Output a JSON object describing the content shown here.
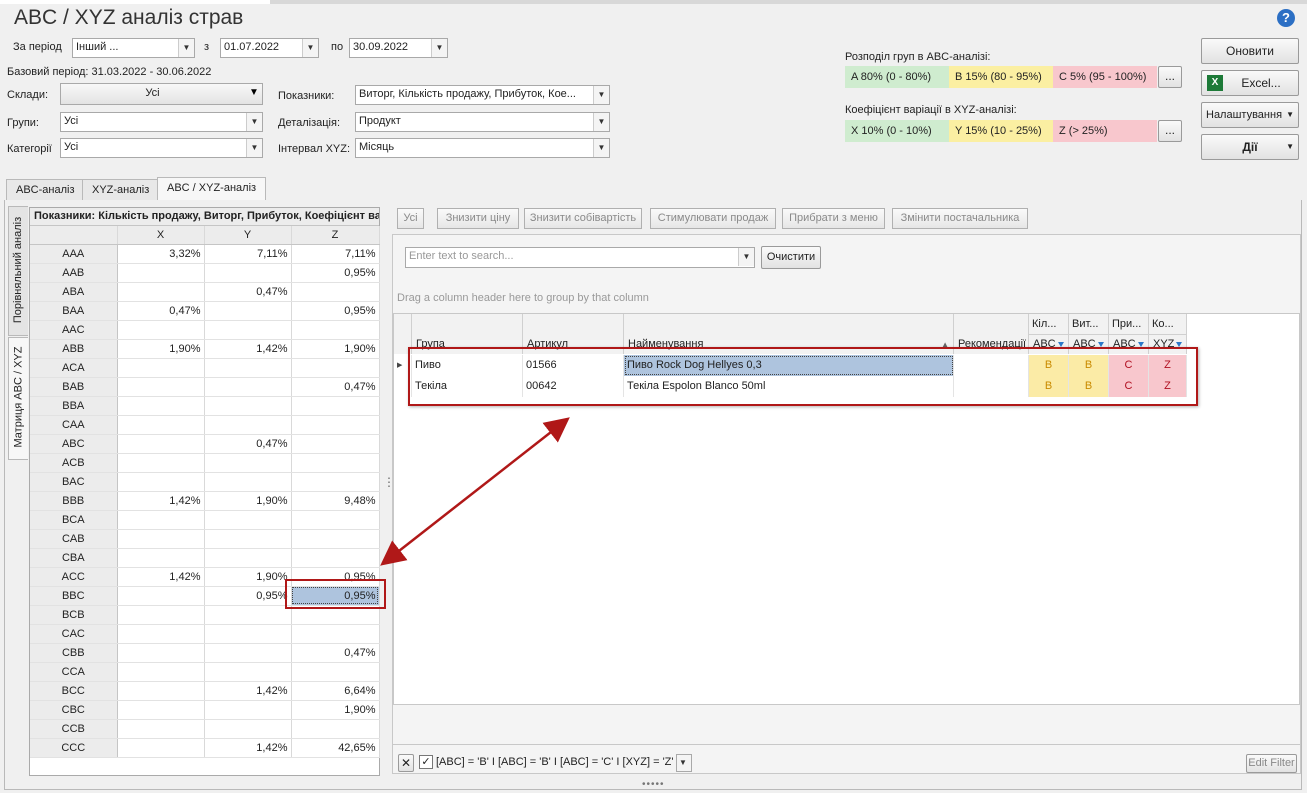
{
  "window": {
    "title": "ABC / XYZ аналіз страв"
  },
  "period": {
    "label": "За період",
    "type": "Інший ...",
    "from_label": "з",
    "from": "01.07.2022",
    "to_label": "по",
    "to": "30.09.2022",
    "base": "Базовий період: 31.03.2022 - 30.06.2022"
  },
  "filters": {
    "warehouses_label": "Склади:",
    "warehouses": "Усі",
    "groups_label": "Групи:",
    "groups": "Усі",
    "categories_label": "Категорії",
    "categories": "Усі",
    "indicators_label": "Показники:",
    "indicators": "Виторг, Кількість продажу, Прибуток, Кое...",
    "detail_label": "Деталізація:",
    "detail": "Продукт",
    "interval_label": "Інтервал XYZ:",
    "interval": "Місяць"
  },
  "abc_dist": {
    "label": "Розподіл груп в ABC-аналізі:",
    "a": "A 80% (0 - 80%)",
    "b": "B 15% (80 - 95%)",
    "c": "C 5% (95 - 100%)",
    "more": "..."
  },
  "xyz_var": {
    "label": "Коефіцієнт варіації в XYZ-аналізі:",
    "x": "X 10% (0 - 10%)",
    "y": "Y 15% (10 - 25%)",
    "z": "Z  (> 25%)",
    "more": "..."
  },
  "buttons": {
    "refresh": "Оновити",
    "excel": "Excel...",
    "settings": "Налаштування",
    "actions": "Дії"
  },
  "tabs": {
    "abc": "ABC-аналіз",
    "xyz": "XYZ-аналіз",
    "abcxyz": "ABC / XYZ-аналіз"
  },
  "side_tabs": {
    "compare": "Порівняльний аналіз",
    "matrix": "Матриця ABC / XYZ"
  },
  "matrix": {
    "caption": "Показники: Кількість продажу, Виторг, Прибуток, Коефіцієнт варіації",
    "cols": [
      "X",
      "Y",
      "Z"
    ],
    "rows": [
      {
        "k": "AAA",
        "x": "3,32%",
        "y": "7,11%",
        "z": "7,11%"
      },
      {
        "k": "AAB",
        "x": "",
        "y": "",
        "z": "0,95%"
      },
      {
        "k": "ABA",
        "x": "",
        "y": "0,47%",
        "z": ""
      },
      {
        "k": "BAA",
        "x": "0,47%",
        "y": "",
        "z": "0,95%"
      },
      {
        "k": "AAC",
        "x": "",
        "y": "",
        "z": ""
      },
      {
        "k": "ABB",
        "x": "1,90%",
        "y": "1,42%",
        "z": "1,90%"
      },
      {
        "k": "ACA",
        "x": "",
        "y": "",
        "z": ""
      },
      {
        "k": "BAB",
        "x": "",
        "y": "",
        "z": "0,47%"
      },
      {
        "k": "BBA",
        "x": "",
        "y": "",
        "z": ""
      },
      {
        "k": "CAA",
        "x": "",
        "y": "",
        "z": ""
      },
      {
        "k": "ABC",
        "x": "",
        "y": "0,47%",
        "z": ""
      },
      {
        "k": "ACB",
        "x": "",
        "y": "",
        "z": ""
      },
      {
        "k": "BAC",
        "x": "",
        "y": "",
        "z": ""
      },
      {
        "k": "BBB",
        "x": "1,42%",
        "y": "1,90%",
        "z": "9,48%"
      },
      {
        "k": "BCA",
        "x": "",
        "y": "",
        "z": ""
      },
      {
        "k": "CAB",
        "x": "",
        "y": "",
        "z": ""
      },
      {
        "k": "CBA",
        "x": "",
        "y": "",
        "z": ""
      },
      {
        "k": "ACC",
        "x": "1,42%",
        "y": "1,90%",
        "z": "0,95%"
      },
      {
        "k": "BBC",
        "x": "",
        "y": "0,95%",
        "z": "0,95%"
      },
      {
        "k": "BCB",
        "x": "",
        "y": "",
        "z": ""
      },
      {
        "k": "CAC",
        "x": "",
        "y": "",
        "z": ""
      },
      {
        "k": "CBB",
        "x": "",
        "y": "",
        "z": "0,47%"
      },
      {
        "k": "CCA",
        "x": "",
        "y": "",
        "z": ""
      },
      {
        "k": "BCC",
        "x": "",
        "y": "1,42%",
        "z": "6,64%"
      },
      {
        "k": "CBC",
        "x": "",
        "y": "",
        "z": "1,90%"
      },
      {
        "k": "CCB",
        "x": "",
        "y": "",
        "z": ""
      },
      {
        "k": "CCC",
        "x": "",
        "y": "1,42%",
        "z": "42,65%"
      }
    ]
  },
  "toolbar": {
    "all": "Усі",
    "lower_price": "Знизити ціну",
    "lower_cost": "Знизити собівартість",
    "stimulate": "Стимулювати продаж",
    "remove": "Прибрати з меню",
    "supplier": "Змінити постачальника"
  },
  "search": {
    "placeholder": "Enter text to search...",
    "clear": "Очистити"
  },
  "group_hint": "Drag a column header here to group by that column",
  "grid": {
    "headers": {
      "group": "Група",
      "article": "Артикул",
      "name": "Найменування",
      "recommend": "Рекомендації",
      "kil": "Кіл...",
      "vit": "Вит...",
      "pri": "При...",
      "ko": "Ко...",
      "abc": "ABC",
      "xyz": "XYZ"
    },
    "rows": [
      {
        "group": "Пиво",
        "article": "01566",
        "name": "Пиво  Rock Dog Hellyes 0,3",
        "a": "B",
        "b": "B",
        "c": "C",
        "z": "Z"
      },
      {
        "group": "Текіла",
        "article": "00642",
        "name": "Текіла Espolon Blanco 50ml",
        "a": "B",
        "b": "B",
        "c": "C",
        "z": "Z"
      }
    ]
  },
  "filter_bar": {
    "text": "[ABC] = 'B' I [ABC] = 'B' I [ABC] = 'C' I [XYZ] = 'Z'",
    "edit": "Edit Filter"
  },
  "colors": {
    "green": "#cfeccf",
    "yellow": "#fbefa2",
    "red": "#f8c7cd",
    "annotation": "#b01818"
  }
}
